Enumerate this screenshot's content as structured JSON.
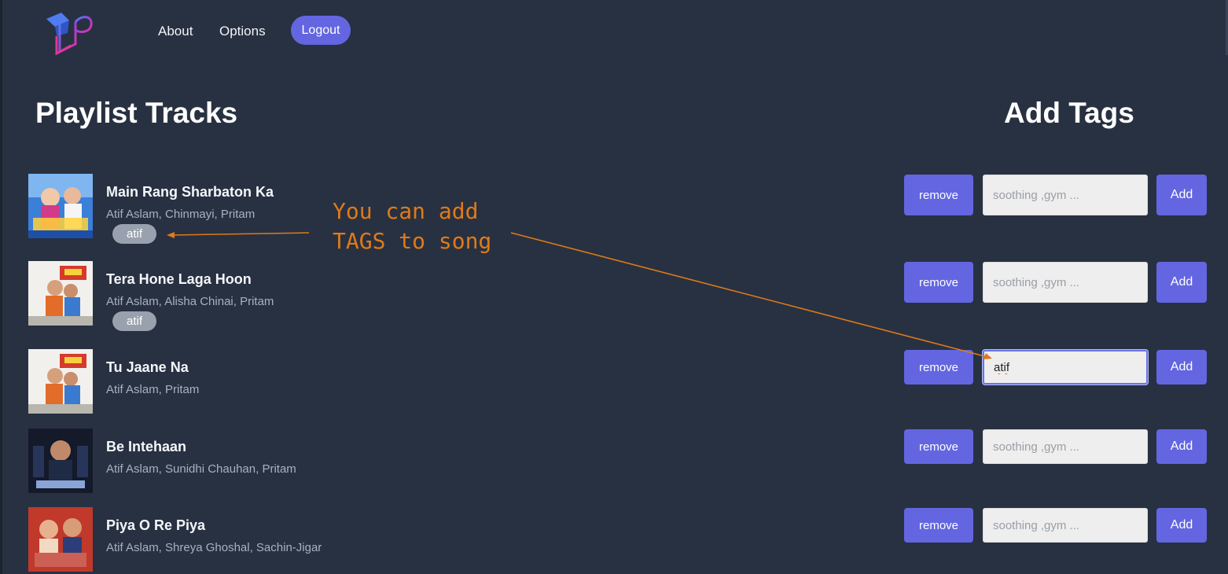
{
  "header": {
    "logo_icon": "music-note-logo-icon",
    "nav": {
      "about": "About",
      "options": "Options"
    },
    "logout": "Logout"
  },
  "headings": {
    "playlist": "Playlist Tracks",
    "add_tags": "Add Tags"
  },
  "annotation": {
    "line1": "You can add",
    "line2": "TAGS to song"
  },
  "tracks": [
    {
      "title": "Main Rang Sharbaton Ka",
      "artists": "Atif Aslam, Chinmayi, Pritam",
      "tag": "atif",
      "remove": "remove",
      "input_value": "",
      "input_placeholder": "soothing ,gym ...",
      "add": "Add"
    },
    {
      "title": "Tera Hone Laga Hoon",
      "artists": "Atif Aslam, Alisha Chinai, Pritam",
      "tag": "atif",
      "remove": "remove",
      "input_value": "",
      "input_placeholder": "soothing ,gym ...",
      "add": "Add"
    },
    {
      "title": "Tu Jaane Na",
      "artists": "Atif Aslam, Pritam",
      "tag": "",
      "remove": "remove",
      "input_value": "atif",
      "input_placeholder": "soothing ,gym ...",
      "add": "Add"
    },
    {
      "title": "Be Intehaan",
      "artists": "Atif Aslam, Sunidhi Chauhan, Pritam",
      "tag": "",
      "remove": "remove",
      "input_value": "",
      "input_placeholder": "soothing ,gym ...",
      "add": "Add"
    },
    {
      "title": "Piya O Re Piya",
      "artists": "Atif Aslam, Shreya Ghoshal, Sachin-Jigar",
      "tag": "",
      "remove": "remove",
      "input_value": "",
      "input_placeholder": "soothing ,gym ...",
      "add": "Add"
    }
  ],
  "colors": {
    "background": "#283141",
    "accent": "#6366e0",
    "tag_pill": "#9aa1ae",
    "annotation": "#e07a18"
  }
}
